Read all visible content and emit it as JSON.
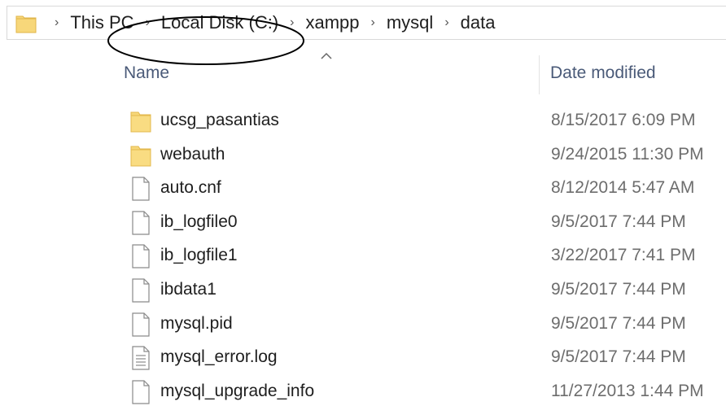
{
  "breadcrumb": {
    "items": [
      "This PC",
      "Local Disk (C:)",
      "xampp",
      "mysql",
      "data"
    ]
  },
  "columns": {
    "name": "Name",
    "date_modified": "Date modified",
    "sort_indicator": "up-caret-icon"
  },
  "files": [
    {
      "name": "ucsg_pasantias",
      "date": "8/15/2017 6:09 PM",
      "icon": "folder-icon"
    },
    {
      "name": "webauth",
      "date": "9/24/2015 11:30 PM",
      "icon": "folder-icon"
    },
    {
      "name": "auto.cnf",
      "date": "8/12/2014 5:47 AM",
      "icon": "file-icon"
    },
    {
      "name": "ib_logfile0",
      "date": "9/5/2017 7:44 PM",
      "icon": "file-icon"
    },
    {
      "name": "ib_logfile1",
      "date": "3/22/2017 7:41 PM",
      "icon": "file-icon"
    },
    {
      "name": "ibdata1",
      "date": "9/5/2017 7:44 PM",
      "icon": "file-icon"
    },
    {
      "name": "mysql.pid",
      "date": "9/5/2017 7:44 PM",
      "icon": "file-icon"
    },
    {
      "name": "mysql_error.log",
      "date": "9/5/2017 7:44 PM",
      "icon": "text-file-icon"
    },
    {
      "name": "mysql_upgrade_info",
      "date": "11/27/2013 1:44 PM",
      "icon": "file-icon"
    }
  ],
  "colors": {
    "folder": "#f7d77a",
    "folder_dark": "#e6b94a",
    "header_text": "#4a5a78",
    "date_text": "#6d6d6d"
  }
}
